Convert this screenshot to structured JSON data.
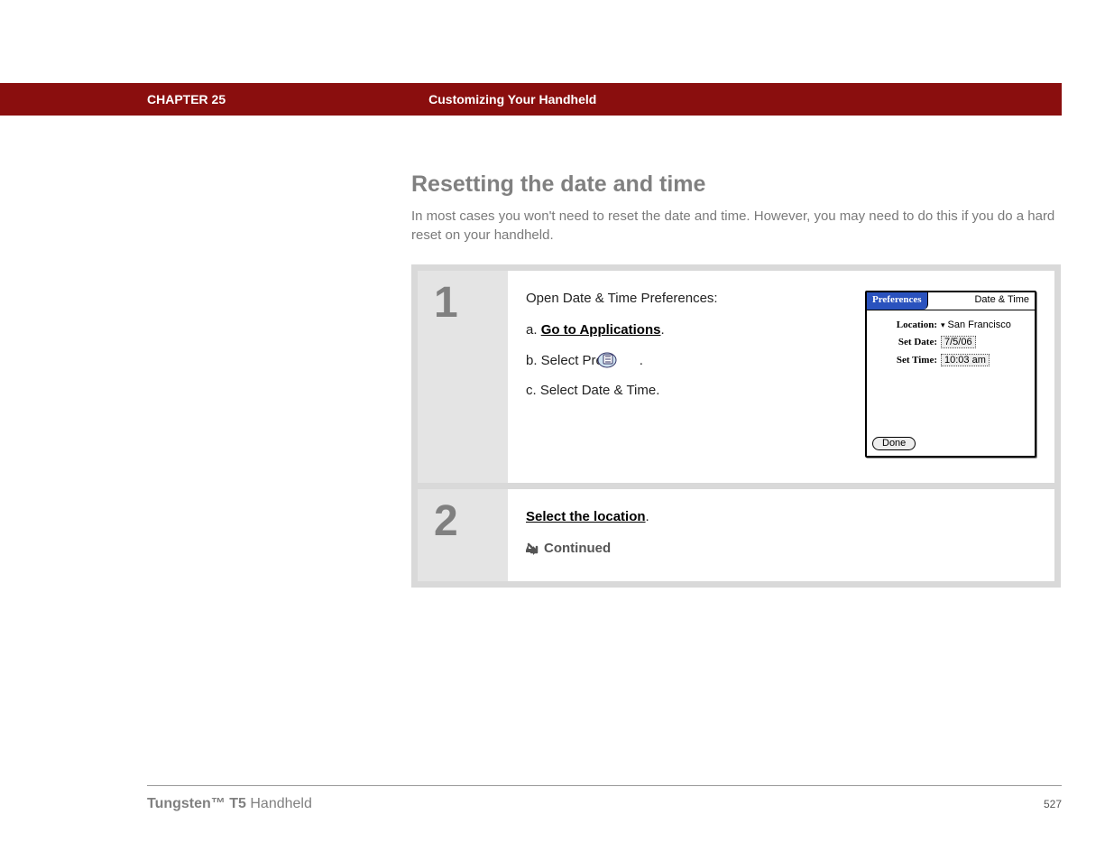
{
  "header": {
    "chapter_label": "CHAPTER 25",
    "chapter_title": "Customizing Your Handheld"
  },
  "section": {
    "heading": "Resetting the date and time",
    "intro": "In most cases you won't need to reset the date and time. However, you may need to do this if you do a hard reset on your handheld."
  },
  "steps": [
    {
      "num": "1",
      "title": "Open Date & Time Preferences:",
      "substeps": {
        "a_prefix": "a.  ",
        "a_link": "Go to Applications",
        "a_suffix": ".",
        "b_prefix": "b.  Select Prefs ",
        "b_suffix": ".",
        "c": "c.  Select Date & Time."
      }
    },
    {
      "num": "2",
      "link": "Select the location",
      "link_suffix": ".",
      "continued": "Continued"
    }
  ],
  "palm": {
    "title_left": "Preferences",
    "title_right": "Date & Time",
    "location_label": "Location:",
    "location_value": "San Francisco",
    "date_label": "Set Date:",
    "date_value": "7/5/06",
    "time_label": "Set Time:",
    "time_value": "10:03 am",
    "done": "Done"
  },
  "footer": {
    "product_bold": "Tungsten™ T5",
    "product_rest": " Handheld",
    "page": "527"
  }
}
